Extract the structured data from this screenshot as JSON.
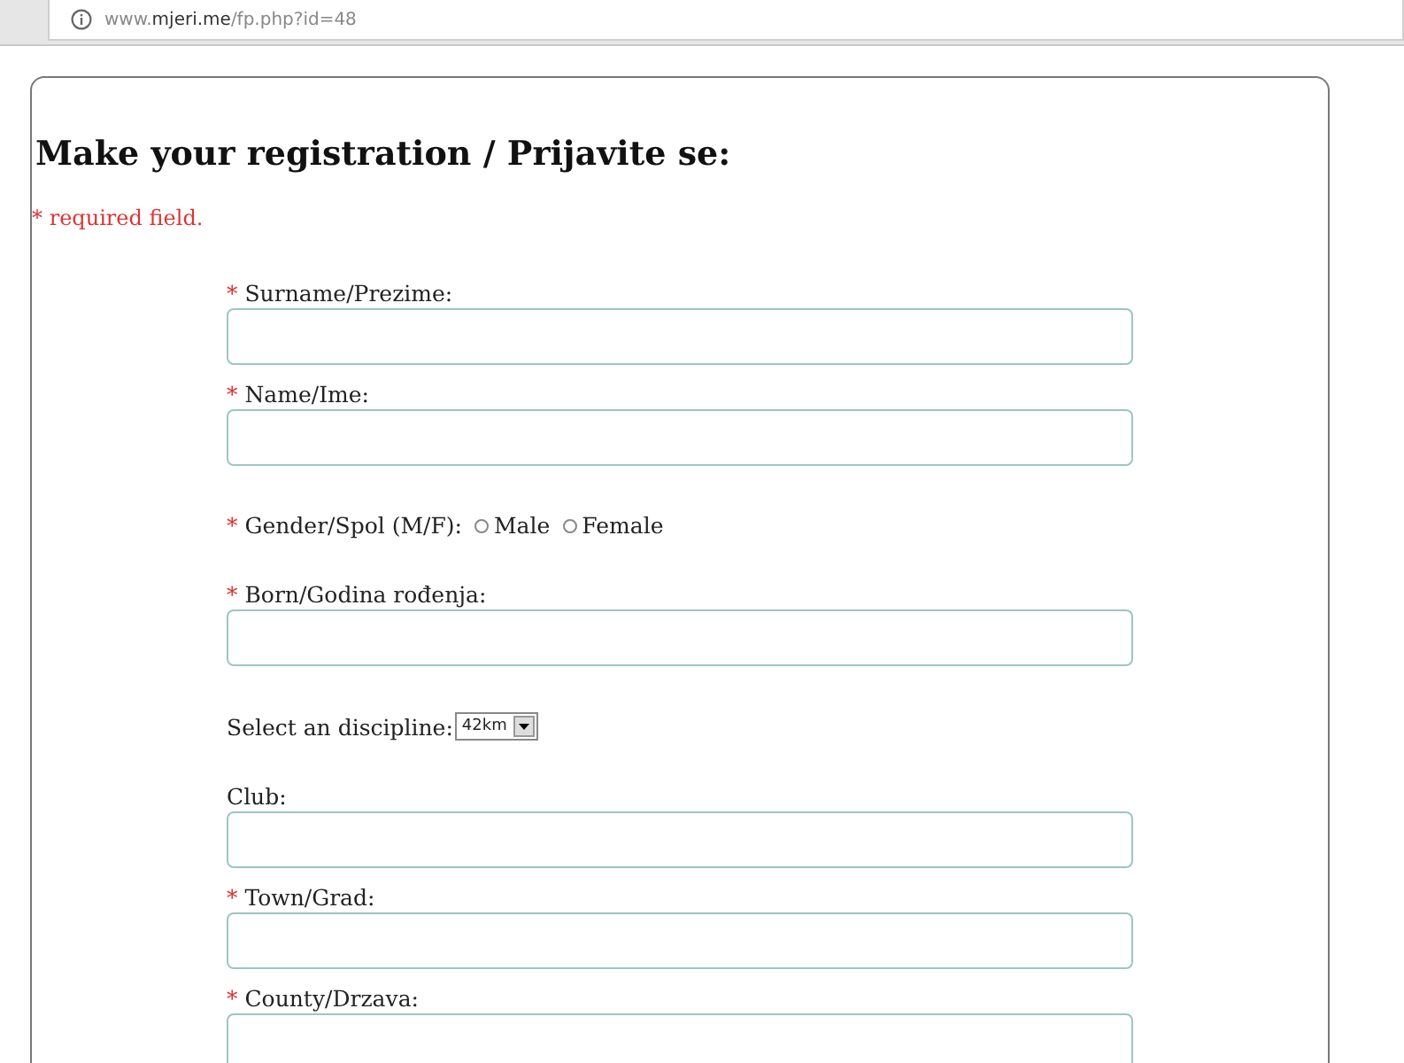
{
  "address_bar": {
    "url": "www.**mjeri.me**/fp.php?id=48"
  },
  "form": {
    "title": "Make your registration / Prijavite se:",
    "required_note": {
      "mark": "*",
      "text": "required field."
    },
    "fields": [
      {
        "kind": "text",
        "required": true,
        "label": "Surname/Prezime:"
      },
      {
        "kind": "text",
        "required": true,
        "label": "Name/Ime:"
      },
      {
        "kind": "radio",
        "required": true,
        "label": "Gender/Spol (M/F):",
        "options": [
          {
            "label": "Male",
            "selected": false
          },
          {
            "label": "Female",
            "selected": false
          }
        ]
      },
      {
        "kind": "text",
        "required": true,
        "label": "Born/Godina rođenja:"
      },
      {
        "kind": "select",
        "required": false,
        "label": "Select an discipline:",
        "value": "42km"
      },
      {
        "kind": "text",
        "required": false,
        "label": "Club:"
      },
      {
        "kind": "text",
        "required": true,
        "label": "Town/Grad:"
      },
      {
        "kind": "text",
        "required": true,
        "label": "County/Drzava:"
      }
    ]
  }
}
